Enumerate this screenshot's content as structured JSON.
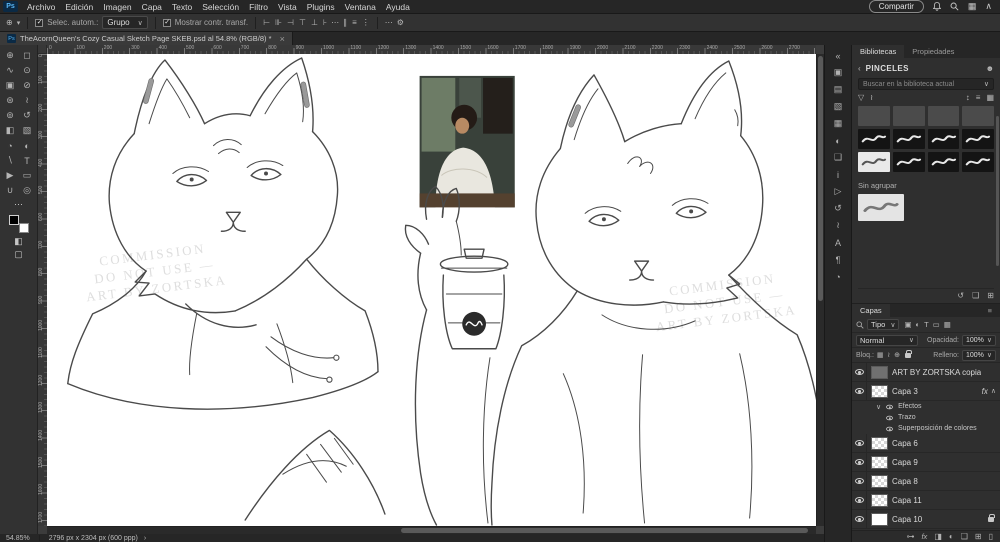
{
  "app": {
    "logo": "Ps"
  },
  "menubar": {
    "items": [
      "Archivo",
      "Edición",
      "Imagen",
      "Capa",
      "Texto",
      "Selección",
      "Filtro",
      "Vista",
      "Plugins",
      "Ventana",
      "Ayuda"
    ]
  },
  "topbar": {
    "share_label": "Compartir"
  },
  "options": {
    "auto_select_label": "Selec. autom.:",
    "auto_select_value": "Grupo",
    "auto_select_checked": true,
    "show_transform_label": "Mostrar contr. transf.",
    "show_transform_checked": true,
    "align_icons": [
      {
        "id": "align-left-icon",
        "glyph": "⊢"
      },
      {
        "id": "align-center-h-icon",
        "glyph": "⊪"
      },
      {
        "id": "align-right-icon",
        "glyph": "⊣"
      },
      {
        "id": "align-top-icon",
        "glyph": "⊤"
      },
      {
        "id": "align-center-v-icon",
        "glyph": "⊥"
      },
      {
        "id": "align-bottom-icon",
        "glyph": "⊦"
      }
    ],
    "dist_icons": [
      {
        "id": "distribute-horizontal-icon",
        "glyph": "∥"
      },
      {
        "id": "distribute-vertical-icon",
        "glyph": "≡"
      },
      {
        "id": "distribute-spacing-icon",
        "glyph": "⋮"
      }
    ]
  },
  "document": {
    "tab_title": "TheAcornQueen's Cozy Casual Sketch Page SKEB.psd al 54.8% (RGB/8) *"
  },
  "toolbar": {
    "tools": [
      {
        "id": "move-tool",
        "glyph": "⊕"
      },
      {
        "id": "marquee-tool",
        "glyph": "◻"
      },
      {
        "id": "lasso-tool",
        "glyph": "∿"
      },
      {
        "id": "object-selection-tool",
        "glyph": "⊙"
      },
      {
        "id": "crop-tool",
        "glyph": "▣"
      },
      {
        "id": "eyedropper-tool",
        "glyph": "⊘"
      },
      {
        "id": "healing-brush-tool",
        "glyph": "⊛"
      },
      {
        "id": "brush-tool",
        "glyph": "≀"
      },
      {
        "id": "clone-stamp-tool",
        "glyph": "⊚"
      },
      {
        "id": "history-brush-tool",
        "glyph": "↺"
      },
      {
        "id": "eraser-tool",
        "glyph": "◧"
      },
      {
        "id": "gradient-tool",
        "glyph": "▧"
      },
      {
        "id": "blur-tool",
        "glyph": "◔"
      },
      {
        "id": "dodge-tool",
        "glyph": "◐"
      },
      {
        "id": "pen-tool",
        "glyph": "∖"
      },
      {
        "id": "type-tool",
        "glyph": "T"
      },
      {
        "id": "path-selection-tool",
        "glyph": "▶"
      },
      {
        "id": "shape-tool",
        "glyph": "▭"
      },
      {
        "id": "hand-tool",
        "glyph": "∪"
      },
      {
        "id": "zoom-tool",
        "glyph": "◎"
      }
    ]
  },
  "panel_strip": {
    "icons": [
      {
        "id": "collapse-panels-icon",
        "glyph": "«"
      },
      {
        "id": "color-panel-icon",
        "glyph": "▣"
      },
      {
        "id": "swatches-panel-icon",
        "glyph": "▤"
      },
      {
        "id": "gradients-panel-icon",
        "glyph": "▧"
      },
      {
        "id": "patterns-panel-icon",
        "glyph": "▦"
      },
      {
        "id": "adjustments-panel-icon",
        "glyph": "◐"
      },
      {
        "id": "libraries-panel-icon",
        "glyph": "❑"
      },
      {
        "id": "info-panel-icon",
        "glyph": "i"
      },
      {
        "id": "comments-panel-icon",
        "glyph": "▷"
      },
      {
        "id": "history-panel-icon",
        "glyph": "↺"
      },
      {
        "id": "brushes-panel-icon",
        "glyph": "≀"
      },
      {
        "id": "character-panel-icon",
        "glyph": "A"
      },
      {
        "id": "paragraph-panel-icon",
        "glyph": "¶"
      },
      {
        "id": "timeline-panel-icon",
        "glyph": "◔"
      }
    ]
  },
  "libraries": {
    "tab_libraries": "Bibliotecas",
    "tab_properties": "Propiedades",
    "header": "PINCELES",
    "search_placeholder": "Buscar en la biblioteca actual",
    "group_label": "Sin agrupar",
    "brushes": [
      {
        "style": "plain"
      },
      {
        "style": "plain"
      },
      {
        "style": "plain"
      },
      {
        "style": "plain"
      },
      {
        "style": "dark"
      },
      {
        "style": "dark"
      },
      {
        "style": "dark"
      },
      {
        "style": "dark"
      },
      {
        "style": "white"
      },
      {
        "style": "dark"
      },
      {
        "style": "dark"
      },
      {
        "style": "dark"
      }
    ],
    "bottom_icons": [
      {
        "id": "library-sync-icon",
        "glyph": "↺"
      },
      {
        "id": "new-group-icon",
        "glyph": "❑"
      },
      {
        "id": "add-to-library-icon",
        "glyph": "⊞"
      }
    ]
  },
  "layers_panel": {
    "tab": "Capas",
    "filter_label": "Tipo",
    "filter_icons": [
      {
        "id": "filter-pixel-layers-icon",
        "glyph": "▣"
      },
      {
        "id": "filter-adjustment-layers-icon",
        "glyph": "◐"
      },
      {
        "id": "filter-type-layers-icon",
        "glyph": "T"
      },
      {
        "id": "filter-shape-layers-icon",
        "glyph": "▭"
      },
      {
        "id": "filter-smart-objects-icon",
        "glyph": "▦"
      }
    ],
    "blend_mode": "Normal",
    "opacity_label": "Opacidad:",
    "opacity_value": "100%",
    "lock_label": "Bloq.:",
    "lock_icons": [
      {
        "id": "lock-transparency-icon",
        "glyph": "▦"
      },
      {
        "id": "lock-pixels-icon",
        "glyph": "≀"
      },
      {
        "id": "lock-position-icon",
        "glyph": "⊕"
      }
    ],
    "fill_label": "Relleno:",
    "fill_value": "100%",
    "fx_label": "fx",
    "layers": [
      {
        "name": "ART BY ZORTSKA copia",
        "thumb": "gray",
        "visible": true
      },
      {
        "name": "Capa 3",
        "thumb": "checker",
        "visible": true,
        "fx": true,
        "effects": [
          "Efectos",
          "Trazo",
          "Superposición de colores"
        ]
      },
      {
        "name": "Capa 6",
        "thumb": "checker",
        "visible": true
      },
      {
        "name": "Capa 9",
        "thumb": "checker",
        "visible": true
      },
      {
        "name": "Capa 8",
        "thumb": "checker",
        "visible": true
      },
      {
        "name": "Capa 11",
        "thumb": "checker",
        "visible": true
      },
      {
        "name": "Capa 10",
        "thumb": "white",
        "visible": true,
        "locked": true
      }
    ],
    "bottom_icons": [
      {
        "id": "link-layers-icon",
        "glyph": "⊶"
      },
      {
        "id": "layer-effects-icon",
        "glyph": "fx"
      },
      {
        "id": "add-mask-icon",
        "glyph": "◨"
      },
      {
        "id": "adjustment-layer-icon",
        "glyph": "◐"
      },
      {
        "id": "new-group-icon",
        "glyph": "❑"
      },
      {
        "id": "new-layer-icon",
        "glyph": "⊞"
      },
      {
        "id": "delete-layer-icon",
        "glyph": "▯"
      }
    ]
  },
  "canvas": {
    "watermark_lines": [
      "COMMISSION",
      "DO NOT USE —",
      "ART BY ZORTSKA"
    ]
  },
  "rulers": {
    "start": 0,
    "step": 100,
    "h_count": 28,
    "v_count": 18
  },
  "status": {
    "zoom": "54.85%",
    "doc_info": "2796 px x 2304 px (600 ppp)"
  }
}
